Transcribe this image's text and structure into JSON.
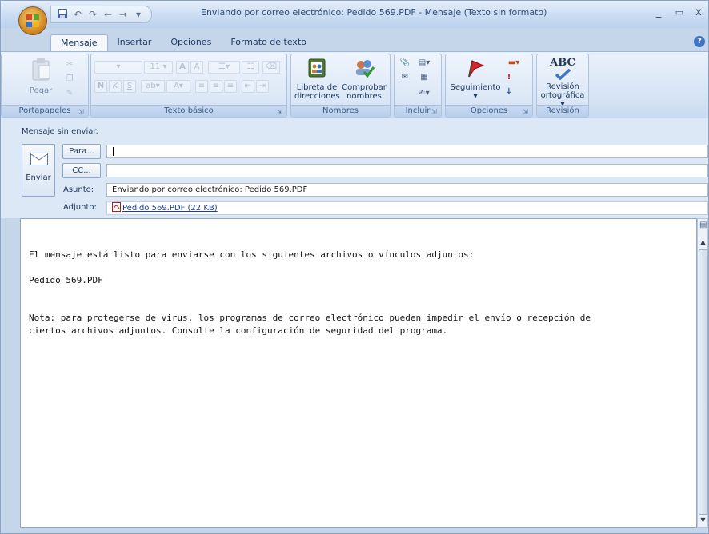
{
  "window": {
    "title": "Enviando por correo electrónico: Pedido 569.PDF - Mensaje (Texto sin formato)",
    "controls": {
      "minimize": "_",
      "maximize": "▭",
      "close": "x"
    }
  },
  "quick_access": {
    "save_icon": "save-icon",
    "undo_icon": "undo-icon",
    "redo_icon": "redo-icon"
  },
  "ribbon": {
    "tabs": [
      "Mensaje",
      "Insertar",
      "Opciones",
      "Formato de texto"
    ],
    "active_tab": "Mensaje",
    "groups": {
      "portapapeles": {
        "label": "Portapapeles",
        "paste": "Pegar"
      },
      "texto_basico": {
        "label": "Texto básico",
        "font_size": "11"
      },
      "nombres": {
        "label": "Nombres",
        "libreta": "Libreta de direcciones",
        "libreta_l1": "Libreta de",
        "libreta_l2": "direcciones",
        "comprobar_l1": "Comprobar",
        "comprobar_l2": "nombres"
      },
      "incluir": {
        "label": "Incluir"
      },
      "opciones": {
        "label": "Opciones",
        "seguimiento": "Seguimiento"
      },
      "revision": {
        "label": "Revisión",
        "abc": "ABC",
        "revision_l1": "Revisión",
        "revision_l2": "ortográfica ▾"
      }
    }
  },
  "compose": {
    "info": "Mensaje sin enviar.",
    "send_label": "Enviar",
    "to_button": "Para...",
    "cc_button": "CC...",
    "to_value": "",
    "cc_value": "",
    "subject_label": "Asunto:",
    "subject_value": "Enviando por correo electrónico: Pedido 569.PDF",
    "attachment_label": "Adjunto:",
    "attachment_value": "Pedido 569.PDF (22 KB)"
  },
  "body": {
    "line1": "El mensaje está listo para enviarse con los siguientes archivos o vínculos adjuntos:",
    "line2": "Pedido 569.PDF",
    "line3": "Nota: para protegerse de virus, los programas de correo electrónico pueden impedir el envío o recepción de",
    "line4": "ciertos archivos adjuntos. Consulte la configuración de seguridad del programa."
  }
}
